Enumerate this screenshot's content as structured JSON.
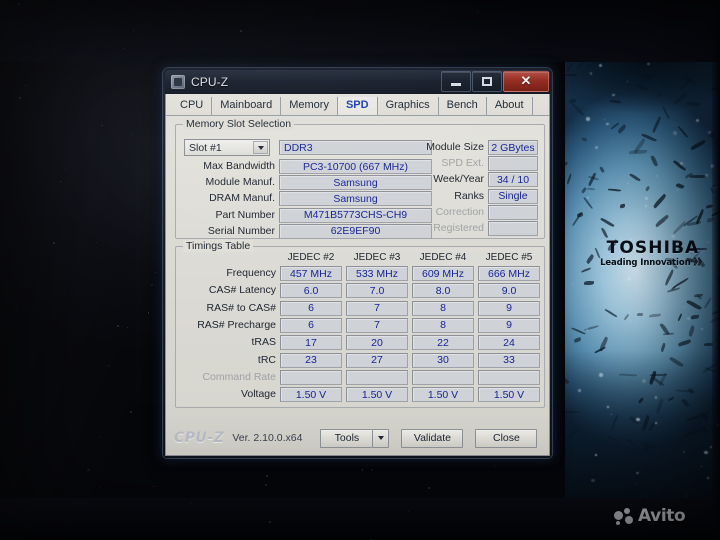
{
  "window": {
    "title": "CPU-Z",
    "app_icon": "cpu-chip-icon",
    "controls": {
      "minimize": "minimize-icon",
      "maximize": "maximize-icon",
      "close": "✕"
    }
  },
  "tabs": [
    {
      "label": "CPU",
      "active": false
    },
    {
      "label": "Mainboard",
      "active": false
    },
    {
      "label": "Memory",
      "active": false
    },
    {
      "label": "SPD",
      "active": true
    },
    {
      "label": "Graphics",
      "active": false
    },
    {
      "label": "Bench",
      "active": false
    },
    {
      "label": "About",
      "active": false
    }
  ],
  "memory_slot_selection": {
    "legend": "Memory Slot Selection",
    "slot_selector": {
      "value": "Slot #1"
    },
    "module_type": "DDR3",
    "left_fields": [
      {
        "label": "Max Bandwidth",
        "value": "PC3-10700 (667 MHz)",
        "dim": false
      },
      {
        "label": "Module Manuf.",
        "value": "Samsung",
        "dim": false
      },
      {
        "label": "DRAM Manuf.",
        "value": "Samsung",
        "dim": false
      },
      {
        "label": "Part Number",
        "value": "M471B5773CHS-CH9",
        "dim": false
      },
      {
        "label": "Serial Number",
        "value": "62E9EF90",
        "dim": false
      }
    ],
    "right_fields": [
      {
        "label": "Module Size",
        "value": "2 GBytes",
        "dim": false
      },
      {
        "label": "SPD Ext.",
        "value": "",
        "dim": true
      },
      {
        "label": "Week/Year",
        "value": "34 / 10",
        "dim": false
      },
      {
        "label": "Ranks",
        "value": "Single",
        "dim": false
      },
      {
        "label": "Correction",
        "value": "",
        "dim": true
      },
      {
        "label": "Registered",
        "value": "",
        "dim": true
      }
    ]
  },
  "timings_table": {
    "legend": "Timings Table",
    "columns": [
      "JEDEC #2",
      "JEDEC #3",
      "JEDEC #4",
      "JEDEC #5"
    ],
    "rows": [
      {
        "label": "Frequency",
        "dim": false,
        "values": [
          "457 MHz",
          "533 MHz",
          "609 MHz",
          "666 MHz"
        ]
      },
      {
        "label": "CAS# Latency",
        "dim": false,
        "values": [
          "6.0",
          "7.0",
          "8.0",
          "9.0"
        ]
      },
      {
        "label": "RAS# to CAS#",
        "dim": false,
        "values": [
          "6",
          "7",
          "8",
          "9"
        ]
      },
      {
        "label": "RAS# Precharge",
        "dim": false,
        "values": [
          "6",
          "7",
          "8",
          "9"
        ]
      },
      {
        "label": "tRAS",
        "dim": false,
        "values": [
          "17",
          "20",
          "22",
          "24"
        ]
      },
      {
        "label": "tRC",
        "dim": false,
        "values": [
          "23",
          "27",
          "30",
          "33"
        ]
      },
      {
        "label": "Command Rate",
        "dim": true,
        "values": [
          "",
          "",
          "",
          ""
        ]
      },
      {
        "label": "Voltage",
        "dim": false,
        "values": [
          "1.50 V",
          "1.50 V",
          "1.50 V",
          "1.50 V"
        ]
      }
    ]
  },
  "bottom_bar": {
    "brand": "CPU-Z",
    "version": "Ver. 2.10.0.x64",
    "tools_label": "Tools",
    "tools_arrow": "chevron-down-icon",
    "validate_label": "Validate",
    "close_label": "Close"
  },
  "desktop": {
    "wallpaper_logo": {
      "word": "TOSHIBA",
      "tagline": "Leading Innovation 》》"
    },
    "watermark": {
      "text": "Avito",
      "mark": "avito-dots-icon"
    }
  },
  "colors": {
    "window_chrome": "#1a2230",
    "field_text": "#16249a",
    "active_tab": "#1b3fbe",
    "close_button": "#a02f23",
    "field_bg": "#cfd2d6"
  }
}
